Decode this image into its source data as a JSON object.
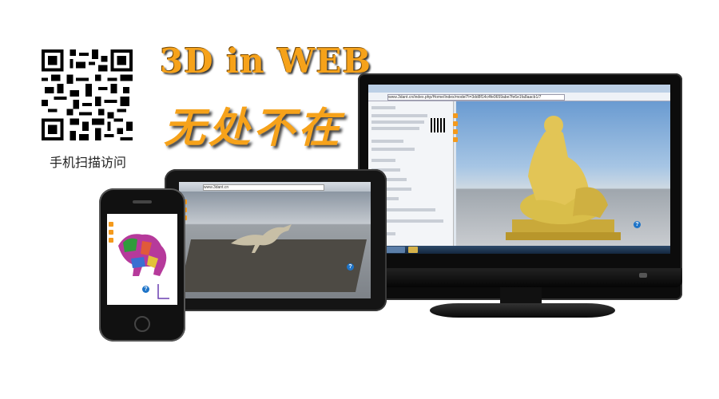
{
  "qr_caption": "手机扫描访问",
  "headline": "3D in WEB",
  "subline": "无处不在",
  "monitor": {
    "address": "www.3dant.cn/index.php/Home/Index/model?i=3dd8f14c4fe0659abe7fe6e1fa8aacb1/7"
  },
  "tablet": {
    "address": "www.3dant.cn"
  },
  "colors": {
    "accent": "#f6a21a",
    "help": "#1e74c8",
    "button": "#f49a1d"
  }
}
